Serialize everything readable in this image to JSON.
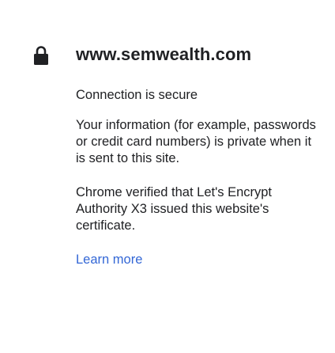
{
  "site": {
    "domain": "www.semwealth.com",
    "connection_status": "Connection is secure",
    "privacy_text": "Your information (for example, passwords or credit card numbers) is private when it is sent to this site.",
    "certificate_text": "Chrome verified that Let's Encrypt Authority X3 issued this website's certificate.",
    "learn_more_label": "Learn more"
  },
  "icons": {
    "status_icon": "lock-icon"
  },
  "colors": {
    "text": "#202124",
    "link": "#3367d6",
    "icon": "#202124",
    "background": "#ffffff"
  }
}
